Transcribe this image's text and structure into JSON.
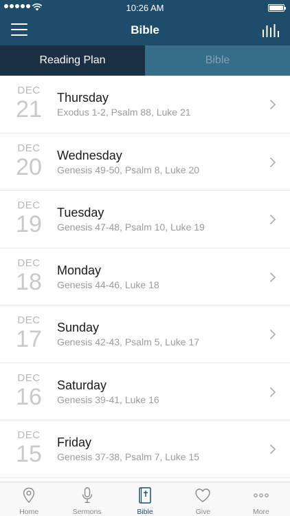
{
  "status_bar": {
    "time": "10:26 AM"
  },
  "header": {
    "title": "Bible",
    "menu_icon": "hamburger-menu-icon",
    "audio_icon": "audio-bars-icon"
  },
  "tabs": [
    {
      "label": "Reading Plan",
      "active": true
    },
    {
      "label": "Bible",
      "active": false
    }
  ],
  "readings": [
    {
      "month": "DEC",
      "day": "21",
      "weekday": "Thursday",
      "passages": "Exodus 1-2, Psalm 88, Luke 21"
    },
    {
      "month": "DEC",
      "day": "20",
      "weekday": "Wednesday",
      "passages": "Genesis 49-50, Psalm 8, Luke 20"
    },
    {
      "month": "DEC",
      "day": "19",
      "weekday": "Tuesday",
      "passages": "Genesis 47-48, Psalm 10, Luke 19"
    },
    {
      "month": "DEC",
      "day": "18",
      "weekday": "Monday",
      "passages": "Genesis 44-46, Luke 18"
    },
    {
      "month": "DEC",
      "day": "17",
      "weekday": "Sunday",
      "passages": "Genesis 42-43, Psalm 5, Luke 17"
    },
    {
      "month": "DEC",
      "day": "16",
      "weekday": "Saturday",
      "passages": "Genesis 39-41, Luke 16"
    },
    {
      "month": "DEC",
      "day": "15",
      "weekday": "Friday",
      "passages": "Genesis 37-38, Psalm 7, Luke 15"
    }
  ],
  "tabbar": [
    {
      "label": "Home",
      "icon": "location-pin-icon",
      "active": false
    },
    {
      "label": "Sermons",
      "icon": "microphone-icon",
      "active": false
    },
    {
      "label": "Bible",
      "icon": "bible-book-icon",
      "active": true
    },
    {
      "label": "Give",
      "icon": "heart-icon",
      "active": false
    },
    {
      "label": "More",
      "icon": "more-dots-icon",
      "active": false
    }
  ],
  "colors": {
    "header_bg": "#1e4c6b",
    "tab_active_bg": "#1b3042",
    "tab_inactive_bg": "#366e8a",
    "tabbar_active": "#1e4c6b",
    "tabbar_inactive": "#8a8a8a"
  }
}
